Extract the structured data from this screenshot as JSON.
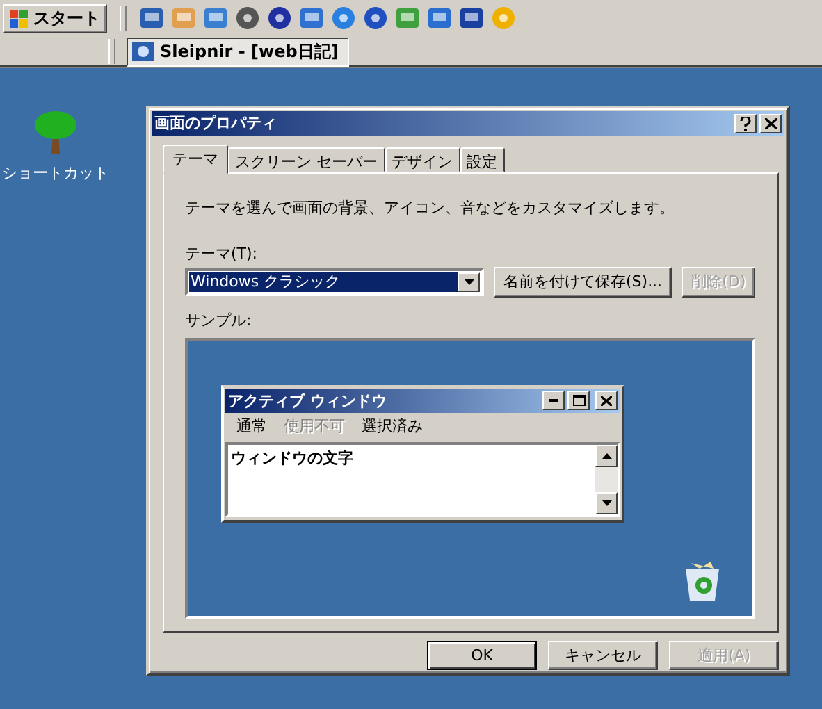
{
  "taskbar": {
    "start_button": {
      "label": "スタート"
    },
    "task_button": {
      "label": "Sleipnir - [web日記]",
      "selected": true
    }
  },
  "desktop_icon": {
    "label": "ショートカット"
  },
  "dialog": {
    "title": "画面のプロパティ",
    "tabs": [
      {
        "label": "テーマ",
        "selected": true
      },
      {
        "label": "スクリーン セーバー",
        "selected": false
      },
      {
        "label": "デザイン",
        "selected": false
      },
      {
        "label": "設定",
        "selected": false
      }
    ],
    "description": "テーマを選んで画面の背景、アイコン、音などをカスタマイズします。",
    "theme_label": "テーマ(T):",
    "theme_select": {
      "value": "Windows クラシック"
    },
    "theme_buttons": [
      {
        "label": "名前を付けて保存(S)...",
        "disabled": false
      },
      {
        "label": "削除(D)",
        "disabled": true
      }
    ],
    "sample_label": "サンプル:",
    "sample": {
      "window_title": "アクティブ ウィンドウ",
      "menu": [
        {
          "label": "通常",
          "disabled": false
        },
        {
          "label": "使用不可",
          "disabled": true
        },
        {
          "label": "選択済み",
          "disabled": false
        }
      ],
      "window_text": "ウィンドウの文字"
    },
    "buttons": [
      {
        "label": "OK",
        "disabled": false
      },
      {
        "label": "キャンセル",
        "disabled": false
      },
      {
        "label": "適用(A)",
        "disabled": true
      }
    ]
  }
}
